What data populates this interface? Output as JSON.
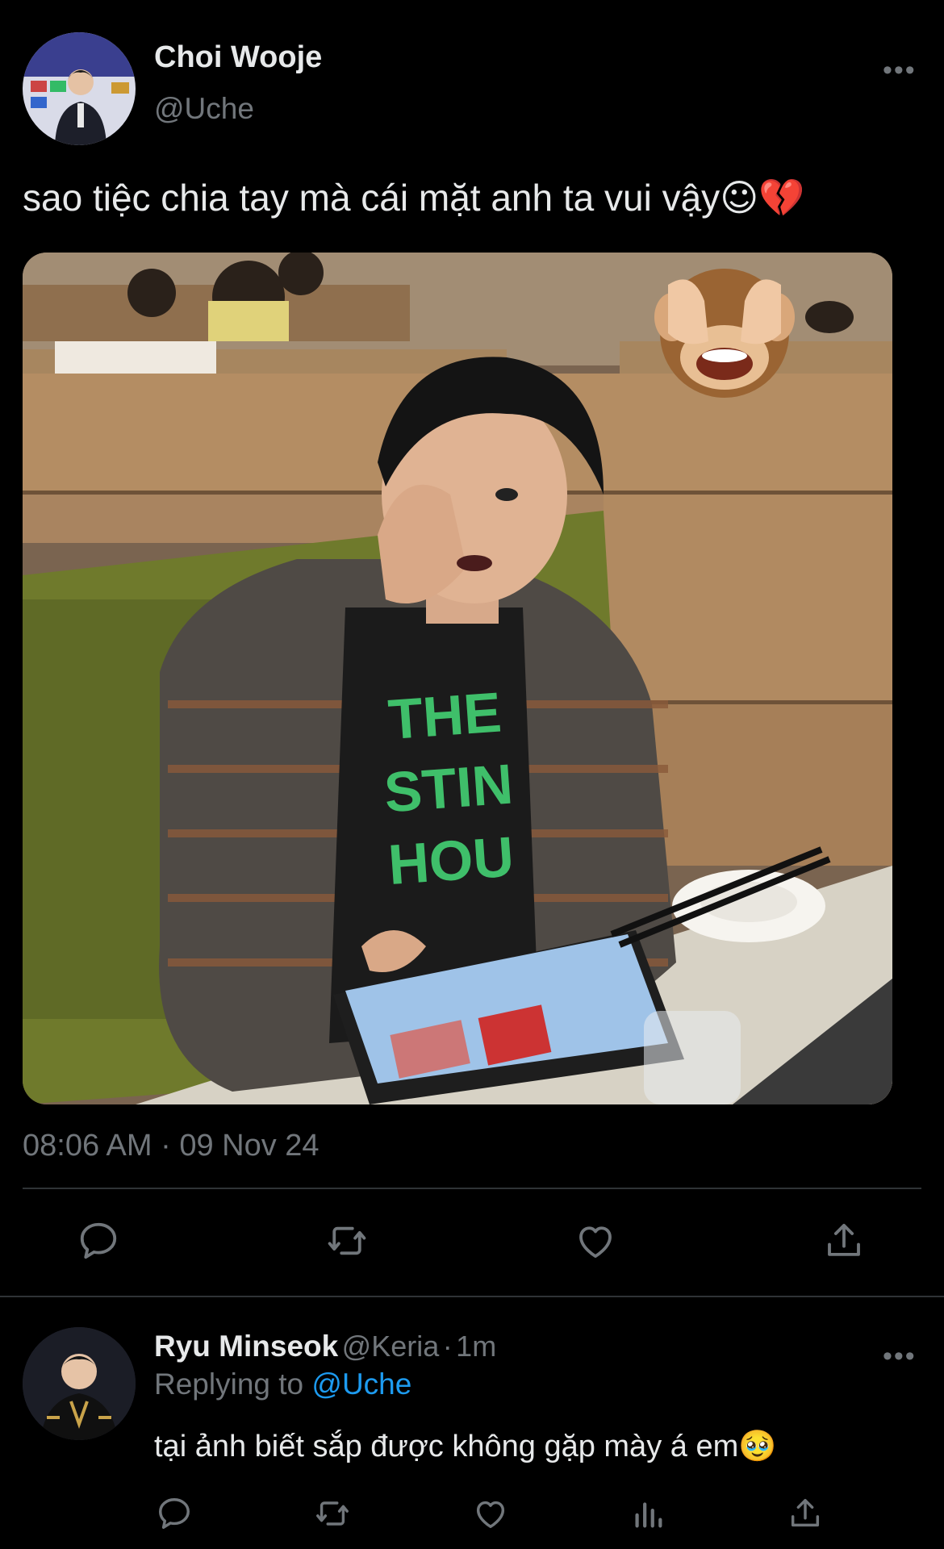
{
  "tweet": {
    "author_name": "Choi Wooje",
    "author_handle": "@Uche",
    "more_glyph": "•••",
    "text": "sao tiệc chia tay mà cái mặt anh ta vui vậy",
    "text_emojis": "☺💔",
    "media_sticker_icon": "see-no-evil-monkey",
    "timestamp": "08:06 AM · 09 Nov 24"
  },
  "actions": {
    "items": [
      "reply",
      "retweet",
      "like",
      "share"
    ]
  },
  "reply": {
    "author_name": "Ryu Minseok",
    "author_handle": "@Keria",
    "separator": "·",
    "time": "1m",
    "replying_prefix": "Replying to",
    "replying_to": "@Uche",
    "more_glyph": "•••",
    "text": "tại ảnh biết sắp được không gặp mày á em",
    "text_emoji": "🥹",
    "actions": [
      "reply",
      "retweet",
      "like",
      "views",
      "share"
    ]
  },
  "colors": {
    "background": "#000000",
    "text_primary": "#e7e9ea",
    "text_secondary": "#71767b",
    "link": "#1d9bf0",
    "divider": "#2f3336"
  }
}
